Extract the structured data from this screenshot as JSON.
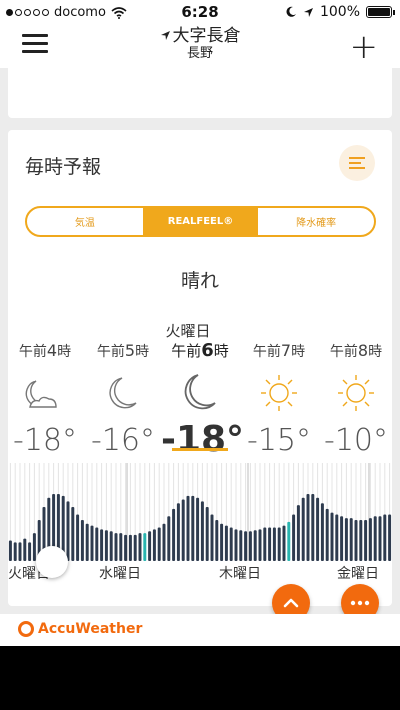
{
  "status_bar": {
    "carrier": "docomo",
    "time": "6:28",
    "battery": "100%",
    "signal_bars": 1,
    "icons": [
      "wifi-icon",
      "moon-icon",
      "location-arrow-icon",
      "battery-icon"
    ]
  },
  "nav": {
    "city": "大字長倉",
    "prefecture": "長野",
    "menu_icon": "hamburger-icon",
    "add_icon": "plus-icon"
  },
  "hourly": {
    "title": "毎時予報",
    "list_icon": "list-icon",
    "tabs": [
      {
        "label": "気温",
        "active": false
      },
      {
        "label": "REALFEEL®",
        "active": true
      },
      {
        "label": "降水確率",
        "active": false
      }
    ],
    "condition": "晴れ",
    "day_name": "火曜日",
    "hours": [
      {
        "prefix": "午前",
        "hour": "4",
        "suffix": "時",
        "temp": "-18°",
        "icon": "moon-cloud-icon",
        "current": false
      },
      {
        "prefix": "午前",
        "hour": "5",
        "suffix": "時",
        "temp": "-16°",
        "icon": "moon-icon",
        "current": false
      },
      {
        "prefix": "午前",
        "hour": "6",
        "suffix": "時",
        "temp": "-18°",
        "icon": "moon-icon",
        "current": true
      },
      {
        "prefix": "午前",
        "hour": "7",
        "suffix": "時",
        "temp": "-15°",
        "icon": "sun-icon",
        "current": false
      },
      {
        "prefix": "午前",
        "hour": "8",
        "suffix": "時",
        "temp": "-10°",
        "icon": "sun-icon",
        "current": false
      }
    ],
    "graph_days": [
      "火曜日",
      "水曜日",
      "木曜日",
      "金曜日"
    ],
    "graph_relative_heights": [
      0.22,
      0.2,
      0.2,
      0.24,
      0.2,
      0.3,
      0.44,
      0.58,
      0.68,
      0.72,
      0.72,
      0.7,
      0.64,
      0.58,
      0.5,
      0.44,
      0.4,
      0.38,
      0.36,
      0.34,
      0.33,
      0.32,
      0.3,
      0.3,
      0.28,
      0.28,
      0.28,
      0.3,
      0.3,
      0.32,
      0.34,
      0.36,
      0.4,
      0.48,
      0.56,
      0.62,
      0.66,
      0.7,
      0.7,
      0.68,
      0.64,
      0.58,
      0.5,
      0.44,
      0.4,
      0.38,
      0.36,
      0.34,
      0.33,
      0.32,
      0.32,
      0.33,
      0.34,
      0.36,
      0.36,
      0.36,
      0.36,
      0.38,
      0.42,
      0.5,
      0.6,
      0.68,
      0.72,
      0.72,
      0.68,
      0.62,
      0.56,
      0.52,
      0.5,
      0.48,
      0.46,
      0.46,
      0.44,
      0.44,
      0.44,
      0.46,
      0.48,
      0.48,
      0.5,
      0.5
    ],
    "graph_highlight_indexes": [
      28,
      58
    ],
    "colors": {
      "bar": "#2e3b4e",
      "highlight": "#2ab5b0",
      "accent": "#f0a81c",
      "moon_icon": "#777777",
      "sun_icon": "#f0a81c"
    }
  },
  "fab": {
    "up_icon": "chevron-up-icon",
    "more_icon": "more-dots-icon",
    "color": "#f26a0e"
  },
  "footer": {
    "brand": "AccuWeather",
    "brand_icon": "accuweather-sun-icon"
  }
}
